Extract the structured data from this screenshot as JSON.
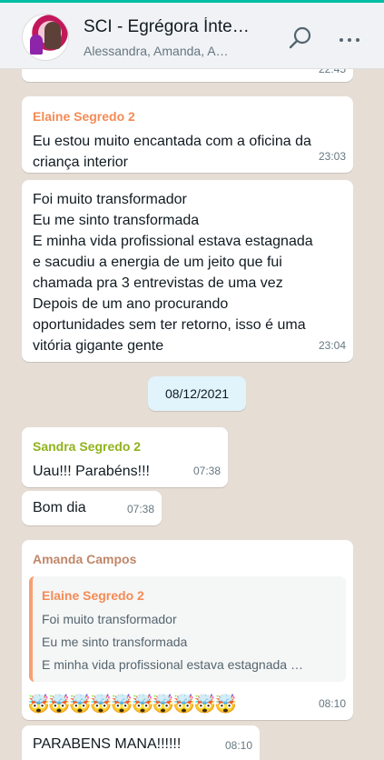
{
  "header": {
    "title": "SCI - Egrégora Ínte…",
    "subtitle": "Alessandra, Amanda, A…",
    "accent_color": "#00bfa5",
    "icons": [
      "search-icon",
      "more-options-icon"
    ]
  },
  "messages": {
    "partial_top": {
      "time": "22:45"
    },
    "elaine_1": {
      "sender": "Elaine Segredo 2",
      "text": "Eu estou muito encantada com a oficina da\ncriança interior",
      "time": "23:03"
    },
    "elaine_2": {
      "text": "Foi muito transformador\nEu me sinto transformada\nE minha vida profissional estava estagnada\ne sacudiu a energia de um jeito que fui\nchamada pra 3 entrevistas de uma vez\nDepois de um ano procurando\noportunidades sem ter retorno, isso é uma\nvitória gigante gente",
      "time": "23:04"
    },
    "date_chip": "08/12/2021",
    "sandra_1": {
      "sender": "Sandra Segredo 2",
      "text": "Uau!!! Parabéns!!!",
      "time": "07:38"
    },
    "sandra_2": {
      "text": "Bom dia",
      "time": "07:38"
    },
    "amanda_1": {
      "sender": "Amanda Campos",
      "quote_sender": "Elaine Segredo 2",
      "quote_lines": [
        "Foi muito transformador",
        "Eu me sinto transformada",
        "E minha vida profissional estava estagnada …"
      ],
      "emojis": "🤯🤯🤯🤯🤯🤯🤯🤯🤯🤯",
      "time": "08:10"
    },
    "amanda_2": {
      "text": "PARABENS MANA!!!!!!",
      "time": "08:10"
    }
  },
  "colors": {
    "elaine_name": "#f58b55",
    "sandra_name": "#8fb31a",
    "amanda_name": "#c0876a",
    "date_chip_bg": "#e1f3fb",
    "wallpaper": "#e6ddd4"
  }
}
